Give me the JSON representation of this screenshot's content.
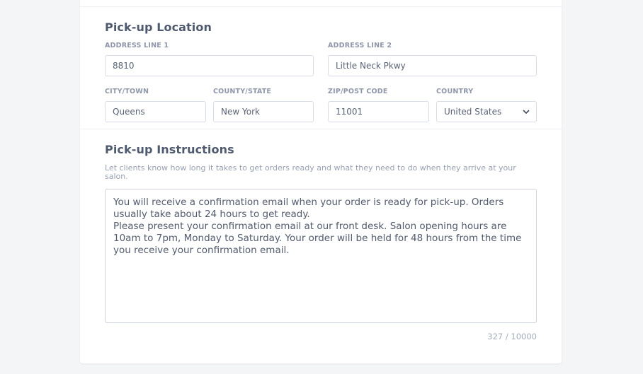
{
  "pickup_location": {
    "title": "Pick-up Location",
    "address_line_1": {
      "label": "ADDRESS LINE 1",
      "value": "8810"
    },
    "address_line_2": {
      "label": "ADDRESS LINE 2",
      "value": "Little Neck Pkwy"
    },
    "city": {
      "label": "CITY/TOWN",
      "value": "Queens"
    },
    "county": {
      "label": "COUNTY/STATE",
      "value": "New York"
    },
    "zip": {
      "label": "ZIP/POST CODE",
      "value": "11001"
    },
    "country": {
      "label": "COUNTRY",
      "value": "United States",
      "icon": "chevron-down-icon"
    }
  },
  "pickup_instructions": {
    "title": "Pick-up Instructions",
    "help": "Let clients know how long it takes to get orders ready and what they need to do when they arrive at your salon.",
    "text_line_1": "You will receive a confirmation email when your order is ready for pick-up. Orders usually take about 24 hours to get ready.",
    "text_line_2": "Please present your confirmation email at our front desk. Salon opening hours are 10am to 7pm, Monday to Saturday. Your order will be held for 48 hours from the time you receive your confirmation email.",
    "counter": "327 / 10000"
  },
  "colors": {
    "page_background": "#f4f5f7",
    "card_background": "#ffffff",
    "field_border": "#d9dde5",
    "heading": "#4f5a6e",
    "label": "#8e97aa"
  }
}
